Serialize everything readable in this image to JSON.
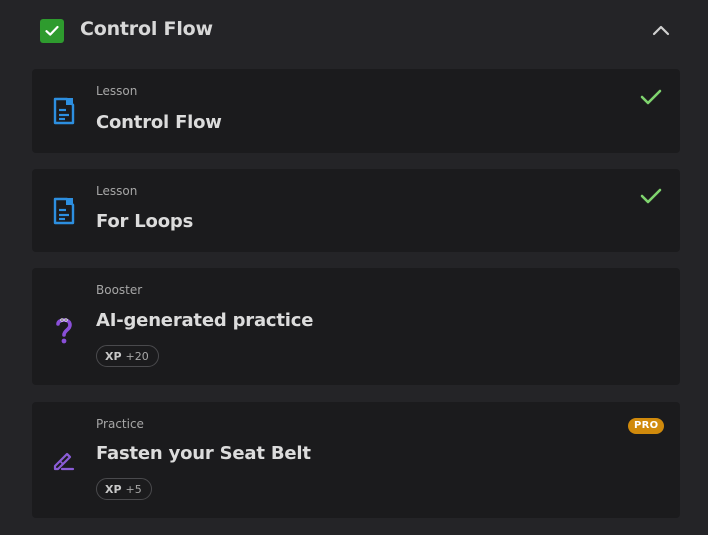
{
  "section": {
    "title": "Control Flow",
    "completed": true,
    "expanded": true
  },
  "items": [
    {
      "kind": "Lesson",
      "title": "Control Flow",
      "icon": "lesson-doc-icon",
      "completed": true
    },
    {
      "kind": "Lesson",
      "title": "For Loops",
      "icon": "lesson-doc-icon",
      "completed": true
    },
    {
      "kind": "Booster",
      "title": "AI-generated practice",
      "icon": "question-mark-icon",
      "xp_label": "XP",
      "xp_value": "+20"
    },
    {
      "kind": "Practice",
      "title": "Fasten your Seat Belt",
      "icon": "edit-pen-icon",
      "xp_label": "XP",
      "xp_value": "+5",
      "badge": "PRO"
    }
  ],
  "colors": {
    "background": "#242427",
    "card": "#1b1b1d",
    "check_green": "#2e9b2e",
    "done_check": "#7fd46e",
    "lesson_icon": "#2d8fe0",
    "practice_icon": "#8a5cd6",
    "pro_badge": "#d08a0c"
  }
}
